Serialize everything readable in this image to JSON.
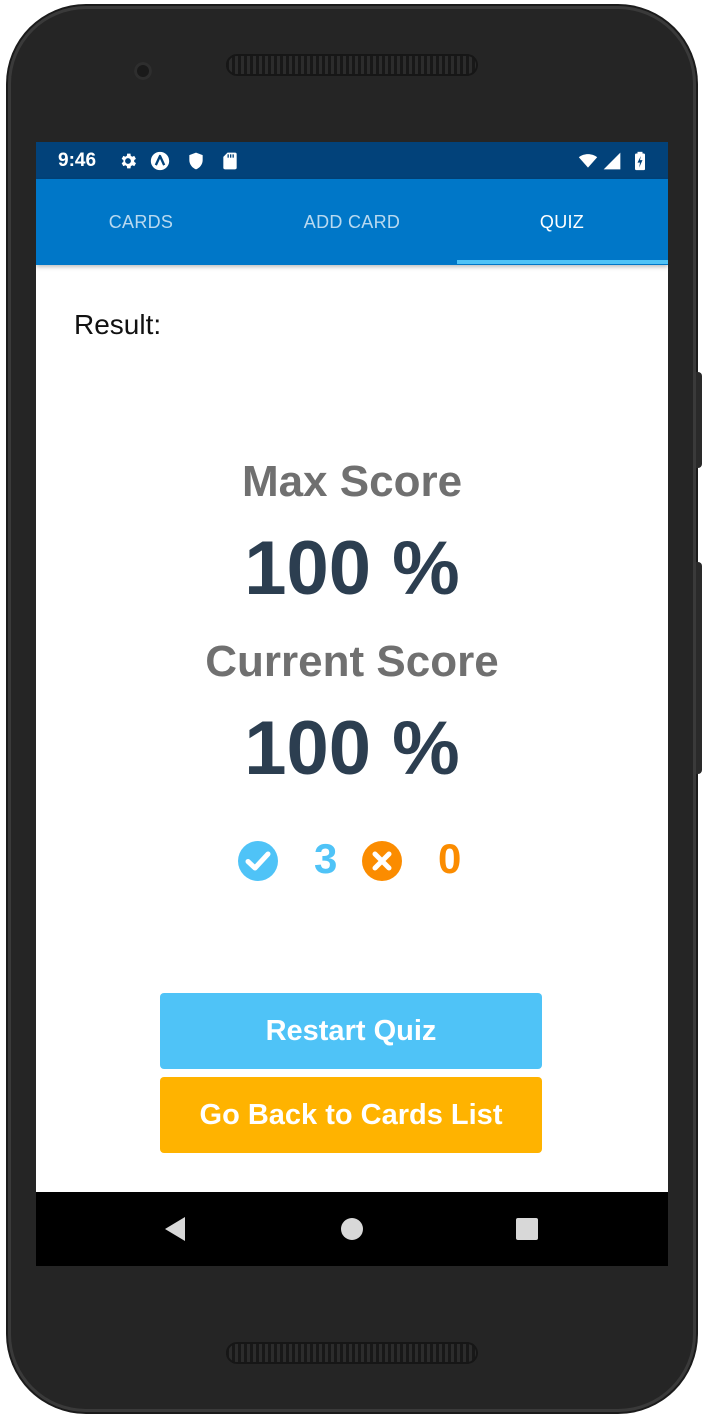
{
  "status_bar": {
    "time": "9:46",
    "left_icons": [
      "gear-icon",
      "app-logo-icon",
      "shield-icon",
      "sd-card-icon"
    ],
    "right_icons": [
      "wifi-icon",
      "signal-icon",
      "battery-charging-icon"
    ]
  },
  "tabs": [
    {
      "label": "CARDS",
      "active": false
    },
    {
      "label": "ADD CARD",
      "active": false
    },
    {
      "label": "QUIZ",
      "active": true
    }
  ],
  "result": {
    "label": "Result:",
    "max_score_heading": "Max Score",
    "max_score_value": "100 %",
    "current_score_heading": "Current Score",
    "current_score_value": "100 %",
    "correct_count": "3",
    "incorrect_count": "0"
  },
  "buttons": {
    "restart_label": "Restart Quiz",
    "go_back_label": "Go Back to Cards List"
  },
  "nav_bar": [
    "back-icon",
    "home-icon",
    "recents-icon"
  ],
  "colors": {
    "status_bar": "#02427a",
    "tab_bar": "#0077c8",
    "tab_indicator": "#4fc3f7",
    "score_value": "#2c3e50",
    "score_heading": "#707070",
    "correct": "#4fc3f7",
    "incorrect": "#fb8c00",
    "restart_button": "#4fc3f7",
    "go_back_button": "#ffb300"
  }
}
